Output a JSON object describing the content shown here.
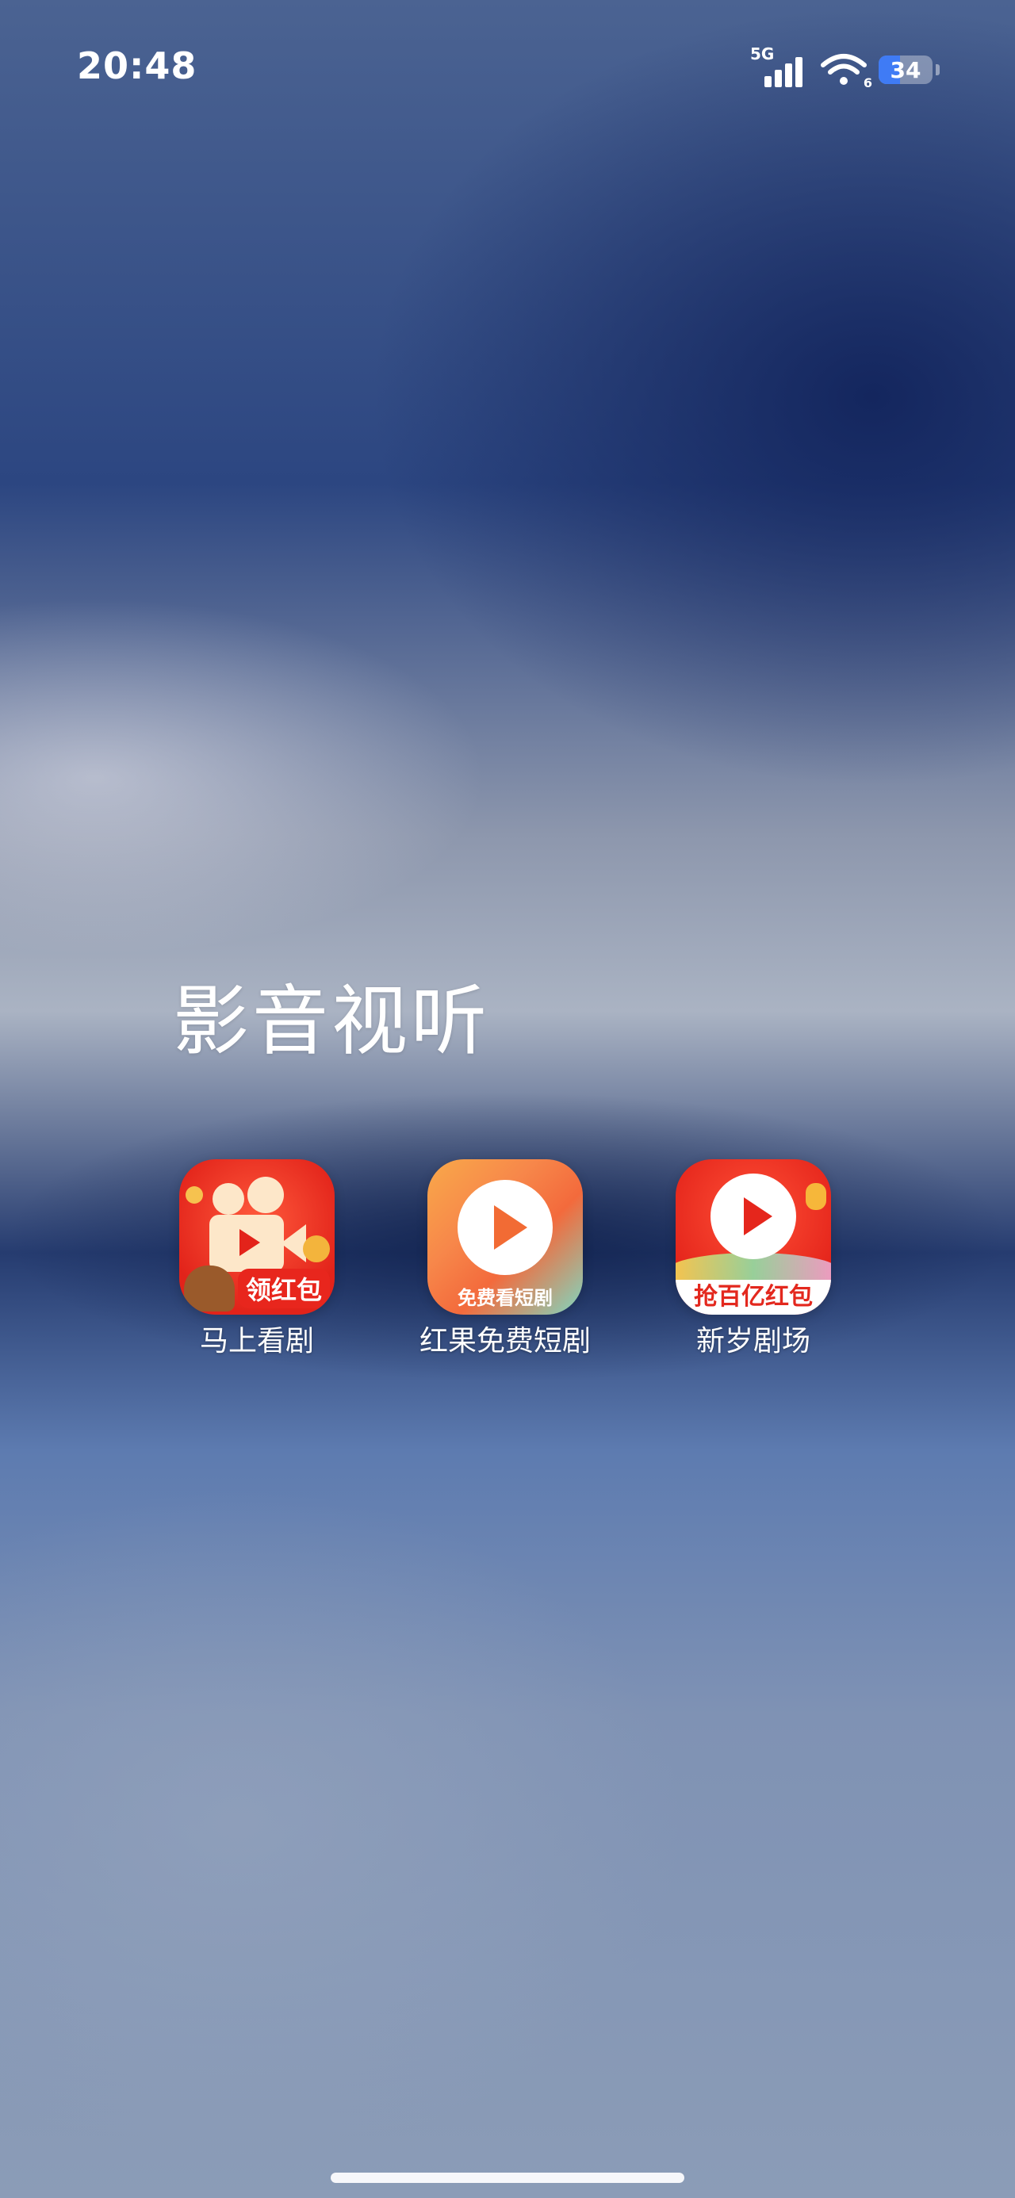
{
  "status_bar": {
    "time": "20:48",
    "network": "5G",
    "battery": "34",
    "wifi_tag": "6"
  },
  "folder": {
    "title": "影音视听",
    "apps": [
      {
        "label": "马上看剧",
        "icon": "video-camera-app-icon",
        "badge": "领红包"
      },
      {
        "label": "红果免费短剧",
        "icon": "play-button-app-icon",
        "badge": "免费看短剧"
      },
      {
        "label": "新岁剧场",
        "icon": "play-circle-app-icon",
        "badge": "抢百亿红包"
      }
    ]
  },
  "colors": {
    "battery_fill": "#3f7bf5",
    "brand_red": "#e5261c",
    "brand_orange": "#f36a3c"
  }
}
